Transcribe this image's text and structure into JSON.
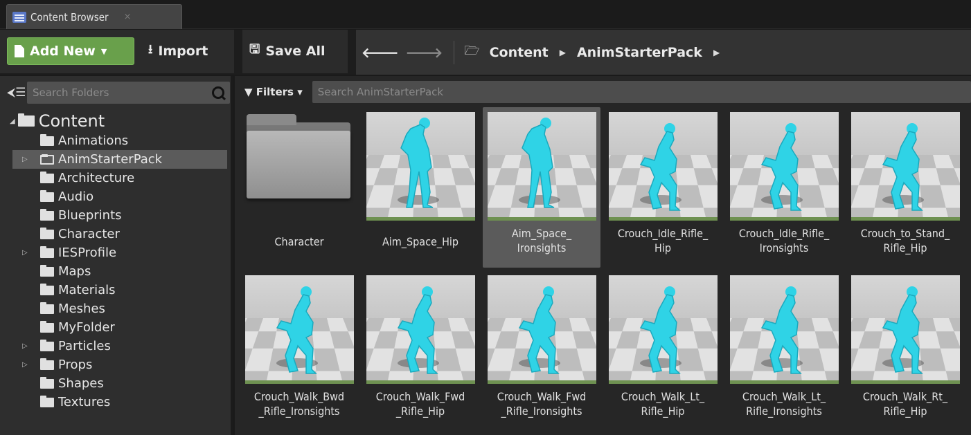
{
  "tab": {
    "label": "Content Browser",
    "close": "×"
  },
  "toolbar": {
    "add_new": "Add New",
    "import": "Import",
    "save_all": "Save All"
  },
  "breadcrumb": [
    "Content",
    "AnimStarterPack"
  ],
  "sidebar": {
    "search_placeholder": "Search Folders",
    "root": "Content",
    "folders": [
      {
        "label": "Animations",
        "expandable": false,
        "selected": false
      },
      {
        "label": "AnimStarterPack",
        "expandable": true,
        "selected": true
      },
      {
        "label": "Architecture",
        "expandable": false,
        "selected": false
      },
      {
        "label": "Audio",
        "expandable": false,
        "selected": false
      },
      {
        "label": "Blueprints",
        "expandable": false,
        "selected": false
      },
      {
        "label": "Character",
        "expandable": false,
        "selected": false
      },
      {
        "label": "IESProfile",
        "expandable": true,
        "selected": false
      },
      {
        "label": "Maps",
        "expandable": false,
        "selected": false
      },
      {
        "label": "Materials",
        "expandable": false,
        "selected": false
      },
      {
        "label": "Meshes",
        "expandable": false,
        "selected": false
      },
      {
        "label": "MyFolder",
        "expandable": false,
        "selected": false
      },
      {
        "label": "Particles",
        "expandable": true,
        "selected": false
      },
      {
        "label": "Props",
        "expandable": true,
        "selected": false
      },
      {
        "label": "Shapes",
        "expandable": false,
        "selected": false
      },
      {
        "label": "Textures",
        "expandable": false,
        "selected": false
      }
    ]
  },
  "assets": {
    "filters_label": "Filters",
    "search_placeholder": "Search AnimStarterPack",
    "items": [
      {
        "label": "Character",
        "kind": "folder",
        "selected": false
      },
      {
        "label": "Aim_Space_Hip",
        "kind": "anim",
        "selected": false
      },
      {
        "label": "Aim_Space_\nIronsights",
        "kind": "anim",
        "selected": true
      },
      {
        "label": "Crouch_Idle_Rifle_\nHip",
        "kind": "anim",
        "selected": false
      },
      {
        "label": "Crouch_Idle_Rifle_\nIronsights",
        "kind": "anim",
        "selected": false
      },
      {
        "label": "Crouch_to_Stand_\nRifle_Hip",
        "kind": "anim",
        "selected": false
      },
      {
        "label": "Crouch_Walk_Bwd\n_Rifle_Ironsights",
        "kind": "anim",
        "selected": false
      },
      {
        "label": "Crouch_Walk_Fwd\n_Rifle_Hip",
        "kind": "anim",
        "selected": false
      },
      {
        "label": "Crouch_Walk_Fwd\n_Rifle_Ironsights",
        "kind": "anim",
        "selected": false
      },
      {
        "label": "Crouch_Walk_Lt_\nRifle_Hip",
        "kind": "anim",
        "selected": false
      },
      {
        "label": "Crouch_Walk_Lt_\nRifle_Ironsights",
        "kind": "anim",
        "selected": false
      },
      {
        "label": "Crouch_Walk_Rt_\nRifle_Hip",
        "kind": "anim",
        "selected": false
      }
    ]
  },
  "colors": {
    "accent_green": "#69a04b",
    "mannequin": "#2fd3e6",
    "selection": "#5b5b5b"
  }
}
